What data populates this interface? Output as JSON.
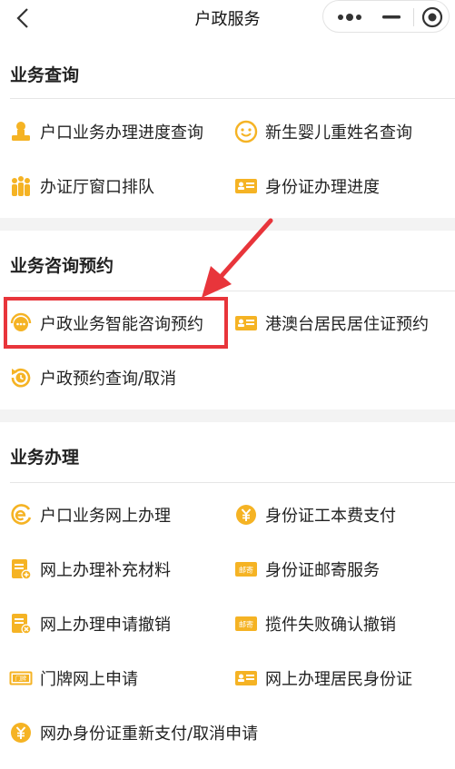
{
  "nav": {
    "title": "户政服务"
  },
  "sections": [
    {
      "title": "业务查询",
      "items": [
        {
          "label": "户口业务办理进度查询",
          "icon": "person-stamp-icon"
        },
        {
          "label": "新生婴儿重姓名查询",
          "icon": "baby-face-icon"
        },
        {
          "label": "办证厅窗口排队",
          "icon": "queue-people-icon"
        },
        {
          "label": "身份证办理进度",
          "icon": "id-card-icon"
        }
      ]
    },
    {
      "title": "业务咨询预约",
      "items": [
        {
          "label": "户政业务智能咨询预约",
          "icon": "chat-headset-icon"
        },
        {
          "label": "港澳台居民居住证预约",
          "icon": "id-card-icon"
        },
        {
          "label": "户政预约查询/取消",
          "icon": "clock-refresh-icon"
        }
      ]
    },
    {
      "title": "业务办理",
      "items": [
        {
          "label": "户口业务网上办理",
          "icon": "e-service-icon"
        },
        {
          "label": "身份证工本费支付",
          "icon": "yuan-coin-icon"
        },
        {
          "label": "网上办理补充材料",
          "icon": "document-add-icon"
        },
        {
          "label": "身份证邮寄服务",
          "icon": "mail-envelope-icon"
        },
        {
          "label": "网上办理申请撤销",
          "icon": "document-cancel-icon"
        },
        {
          "label": "揽件失败确认撤销",
          "icon": "mail-cancel-icon"
        },
        {
          "label": "门牌网上申请",
          "icon": "door-plate-icon"
        },
        {
          "label": "网上办理居民身份证",
          "icon": "id-card-icon"
        },
        {
          "label": "网办身份证重新支付/取消申请",
          "icon": "yuan-coin-icon"
        }
      ]
    }
  ],
  "doorplate_text": "门牌",
  "mail_text": "邮寄",
  "colors": {
    "icon": "#f5b324",
    "highlight": "#e8353b",
    "separator": "#f3f3f3"
  }
}
